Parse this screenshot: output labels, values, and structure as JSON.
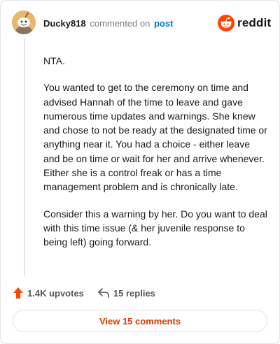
{
  "header": {
    "username": "Ducky818",
    "action": "commented on",
    "post_link": "post",
    "brand": "reddit"
  },
  "comment": {
    "paragraphs": [
      "NTA.",
      "You wanted to get to the ceremony on time and advised Hannah of the time to leave and gave numerous time updates and warnings. She knew and chose to not be ready at the designated time or anything near it. You had a choice - either leave and be on time or wait for her and arrive whenever. Either she is a control freak or has a time management problem and is chronically late.",
      "Consider this a warning by her. Do you want to deal with this time issue (& her juvenile response to being left) going forward."
    ]
  },
  "footer": {
    "upvotes": "1.4K upvotes",
    "replies": "15 replies",
    "view_comments": "View 15 comments"
  },
  "colors": {
    "brand_orange": "#ff4500",
    "link_blue": "#0079d3",
    "button_text": "#d93a00"
  },
  "icons": {
    "avatar": "snoo-avatar",
    "brand": "reddit-logo-icon",
    "upvote": "upvote-arrow-icon",
    "reply": "reply-arrow-icon"
  }
}
